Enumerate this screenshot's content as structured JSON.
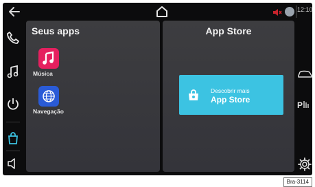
{
  "topbar": {
    "back_icon": "back-arrow-icon",
    "home_icon": "home-icon",
    "status_icons": [
      "mute-icon",
      "status-dot-icon"
    ],
    "clock": "12:10"
  },
  "left_rail": {
    "items": [
      {
        "icon": "phone-icon"
      },
      {
        "icon": "music-note-icon"
      },
      {
        "icon": "power-icon"
      },
      {
        "icon": "apps-bag-icon",
        "active": true
      },
      {
        "icon": "volume-icon"
      }
    ]
  },
  "apps_panel": {
    "title": "Seus apps",
    "apps": [
      {
        "label": "Música",
        "icon": "music-note-icon",
        "color": "#e5205f"
      },
      {
        "label": "Navegação",
        "icon": "globe-icon",
        "color": "#2a5bd7"
      }
    ]
  },
  "store_panel": {
    "title": "App Store",
    "button_line1": "Descobrir mais",
    "button_line2": "App Store",
    "button_color": "#3cc3e2"
  },
  "right_rail": {
    "items": [
      {
        "icon": "car-icon"
      },
      {
        "icon": "park-assist-icon",
        "label": "P"
      },
      {
        "icon": "settings-gear-icon"
      }
    ]
  },
  "figure_tag": "Bra-3114",
  "accent_color": "#3cc3e2"
}
